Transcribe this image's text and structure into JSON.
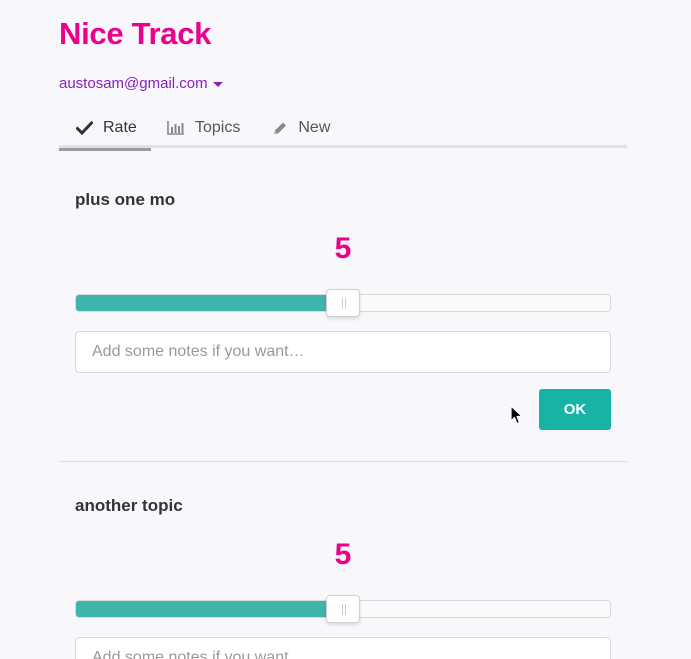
{
  "app": {
    "title": "Nice Track"
  },
  "user": {
    "email": "austosam@gmail.com",
    "menu_icon": "caret-down-icon"
  },
  "tabs": [
    {
      "label": "Rate",
      "icon": "check-icon",
      "active": true
    },
    {
      "label": "Topics",
      "icon": "bar-chart-icon",
      "active": false
    },
    {
      "label": "New",
      "icon": "pencil-icon",
      "active": false
    }
  ],
  "topics": [
    {
      "title": "plus one mo",
      "rating": "5",
      "slider_fraction": 0.5,
      "notes_placeholder": "Add some notes if you want…",
      "ok_label": "OK"
    },
    {
      "title": "another topic",
      "rating": "5",
      "slider_fraction": 0.5,
      "notes_placeholder": "Add some notes if you want…"
    }
  ],
  "colors": {
    "brand": "#ec008c",
    "user_link": "#8a1fc2",
    "accent": "#17b3a6",
    "slider_fill": "#3db5aa"
  }
}
